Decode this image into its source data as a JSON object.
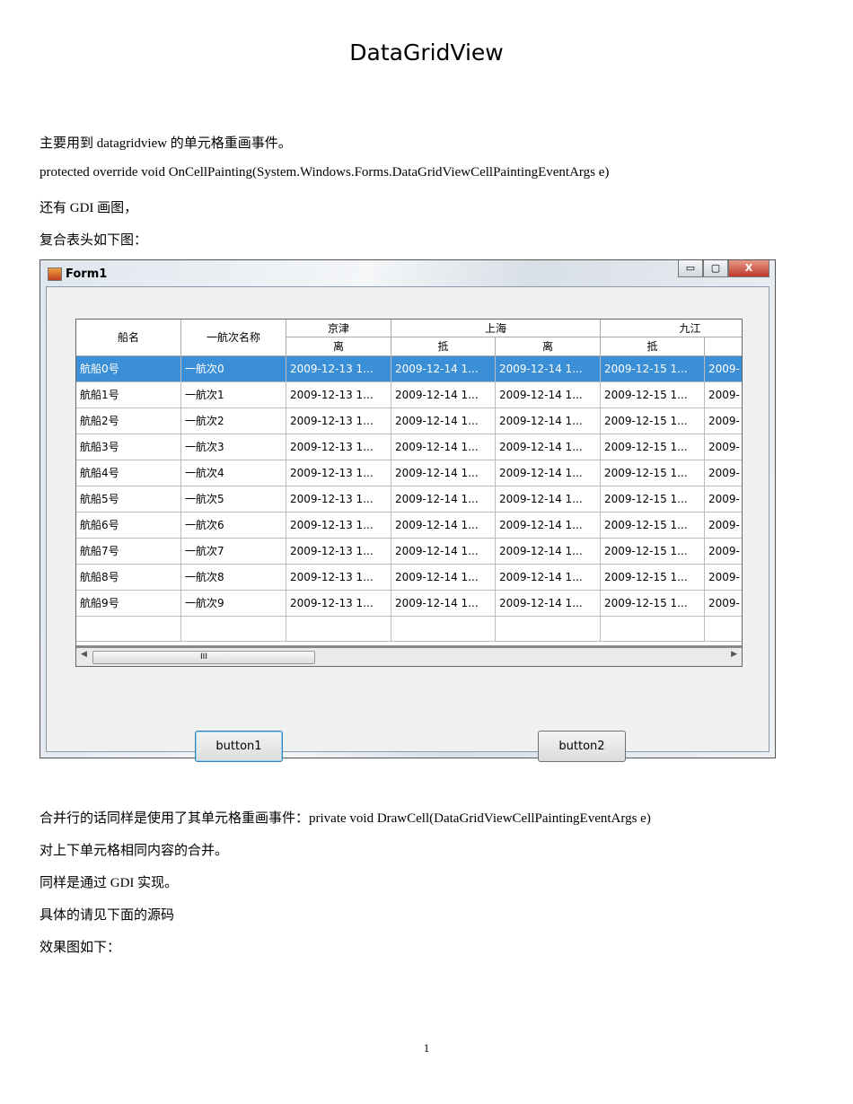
{
  "title": "DataGridView",
  "paragraphs_top": [
    "主要用到 datagridview 的单元格重画事件。",
    "protected override void OnCellPainting(System.Windows.Forms.DataGridViewCellPaintingEventArgs e)",
    "还有 GDI 画图，",
    "复合表头如下图："
  ],
  "form": {
    "title": "Form1",
    "window_buttons": [
      "▭",
      "▢",
      "X"
    ],
    "grid": {
      "headers": {
        "ship": "船名",
        "voyage": "一航次名称",
        "groups": [
          "京津",
          "上海",
          "九江"
        ],
        "sub": [
          "离",
          "抵",
          "离",
          "抵",
          ""
        ]
      },
      "rows": [
        [
          "航船0号",
          "一航次0",
          "2009-12-13 1...",
          "2009-12-14 1...",
          "2009-12-14 1...",
          "2009-12-15 1...",
          "2009-"
        ],
        [
          "航船1号",
          "一航次1",
          "2009-12-13 1...",
          "2009-12-14 1...",
          "2009-12-14 1...",
          "2009-12-15 1...",
          "2009-"
        ],
        [
          "航船2号",
          "一航次2",
          "2009-12-13 1...",
          "2009-12-14 1...",
          "2009-12-14 1...",
          "2009-12-15 1...",
          "2009-"
        ],
        [
          "航船3号",
          "一航次3",
          "2009-12-13 1...",
          "2009-12-14 1...",
          "2009-12-14 1...",
          "2009-12-15 1...",
          "2009-"
        ],
        [
          "航船4号",
          "一航次4",
          "2009-12-13 1...",
          "2009-12-14 1...",
          "2009-12-14 1...",
          "2009-12-15 1...",
          "2009-"
        ],
        [
          "航船5号",
          "一航次5",
          "2009-12-13 1...",
          "2009-12-14 1...",
          "2009-12-14 1...",
          "2009-12-15 1...",
          "2009-"
        ],
        [
          "航船6号",
          "一航次6",
          "2009-12-13 1...",
          "2009-12-14 1...",
          "2009-12-14 1...",
          "2009-12-15 1...",
          "2009-"
        ],
        [
          "航船7号",
          "一航次7",
          "2009-12-13 1...",
          "2009-12-14 1...",
          "2009-12-14 1...",
          "2009-12-15 1...",
          "2009-"
        ],
        [
          "航船8号",
          "一航次8",
          "2009-12-13 1...",
          "2009-12-14 1...",
          "2009-12-14 1...",
          "2009-12-15 1...",
          "2009-"
        ],
        [
          "航船9号",
          "一航次9",
          "2009-12-13 1...",
          "2009-12-14 1...",
          "2009-12-14 1...",
          "2009-12-15 1...",
          "2009-"
        ]
      ],
      "selected_row": 0,
      "scroll_thumb": "III"
    },
    "button1": "button1",
    "button2": "button2"
  },
  "paragraphs_bottom": [
    "合并行的话同样是使用了其单元格重画事件：private void DrawCell(DataGridViewCellPaintingEventArgs e)",
    "对上下单元格相同内容的合并。",
    "同样是通过 GDI 实现。",
    "具体的请见下面的源码",
    "效果图如下："
  ],
  "page_number": "1"
}
